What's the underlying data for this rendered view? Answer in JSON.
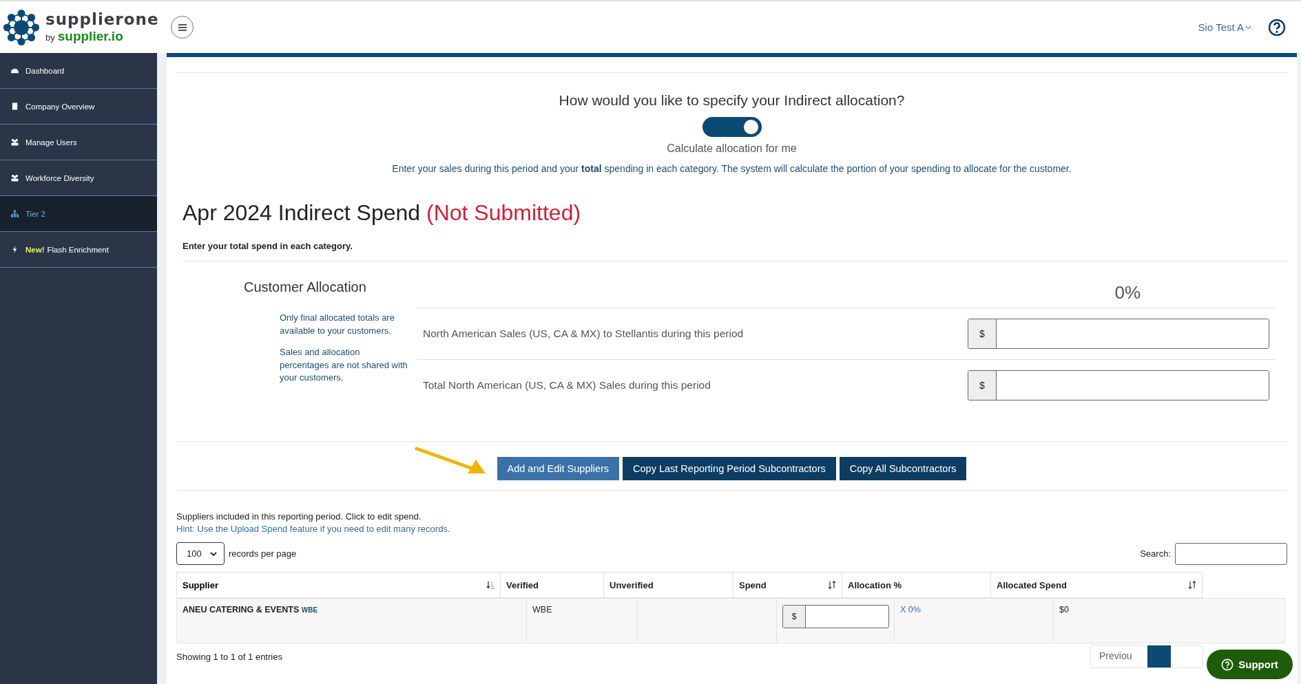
{
  "brand": {
    "name": "supplierone",
    "by": "by",
    "domain": "supplier.io"
  },
  "header": {
    "user_menu": "Sio Test A"
  },
  "sidebar": {
    "items": [
      {
        "label": "Dashboard",
        "selected": false
      },
      {
        "label": "Company Overview",
        "selected": false
      },
      {
        "label": "Manage Users",
        "selected": false
      },
      {
        "label": "Workforce Diversity",
        "selected": false
      },
      {
        "label": "Tier 2",
        "selected": true
      },
      {
        "label": "Flash Enrichment",
        "badge": "New!",
        "selected": false
      }
    ]
  },
  "allocation_mode": {
    "question": "How would you like to specify your Indirect allocation?",
    "toggle_on": true,
    "toggle_label": "Calculate allocation for me",
    "description": "Enter your sales during this period and your **total** spending in each category. The system will calculate the portion of your spending to allocate for the customer."
  },
  "period": {
    "title": "Apr 2024 Indirect Spend",
    "status": "(Not Submitted)",
    "instruction": "Enter your total spend in each category."
  },
  "customer_allocation": {
    "title": "Customer Allocation",
    "percent": "0%",
    "notes": [
      "Only final allocated totals are available to your customers.",
      "Sales and allocation percentages are not shared with your customers."
    ],
    "rows": [
      {
        "label": "North American Sales (US, CA & MX) to Stellantis during this period",
        "currency": "$"
      },
      {
        "label": "Total North American (US, CA & MX) Sales during this period",
        "currency": "$"
      }
    ]
  },
  "buttons": [
    {
      "label": "Add and Edit Suppliers",
      "highlighted": true
    },
    {
      "label": "Copy Last Reporting Period Subcontractors",
      "highlighted": false
    },
    {
      "label": "Copy All Subcontractors",
      "highlighted": false
    }
  ],
  "suppliers": {
    "intro": "Suppliers included in this reporting period. Click to edit spend.",
    "hint_prefix": "Hint: Use the ",
    "hint_link": "Upload Spend",
    "hint_suffix": " feature if you need to edit many records.",
    "page_size": "100",
    "page_size_label": "records per page",
    "search_label": "Search:",
    "columns": [
      {
        "label": "Supplier",
        "sortable": true,
        "sorted": true
      },
      {
        "label": "Verified",
        "sortable": false,
        "sorted": false
      },
      {
        "label": "Unverified",
        "sortable": false,
        "sorted": false
      },
      {
        "label": "Spend",
        "sortable": true,
        "sorted": false
      },
      {
        "label": "Allocation %",
        "sortable": false,
        "sorted": false
      },
      {
        "label": "Allocated Spend",
        "sortable": true,
        "sorted": false
      }
    ],
    "rows": [
      {
        "supplier": "ANEU CATERING & EVENTS",
        "tag": "WBE",
        "verified": "WBE",
        "spend_currency": "$",
        "allocation": "X 0%",
        "allocated_spend": "$0"
      }
    ],
    "summary": "Showing 1 to 1 of 1 entries",
    "pagination": {
      "previous": "Previou",
      "pages": [
        {
          "selected": true
        }
      ]
    }
  },
  "support": {
    "label": "Support"
  }
}
